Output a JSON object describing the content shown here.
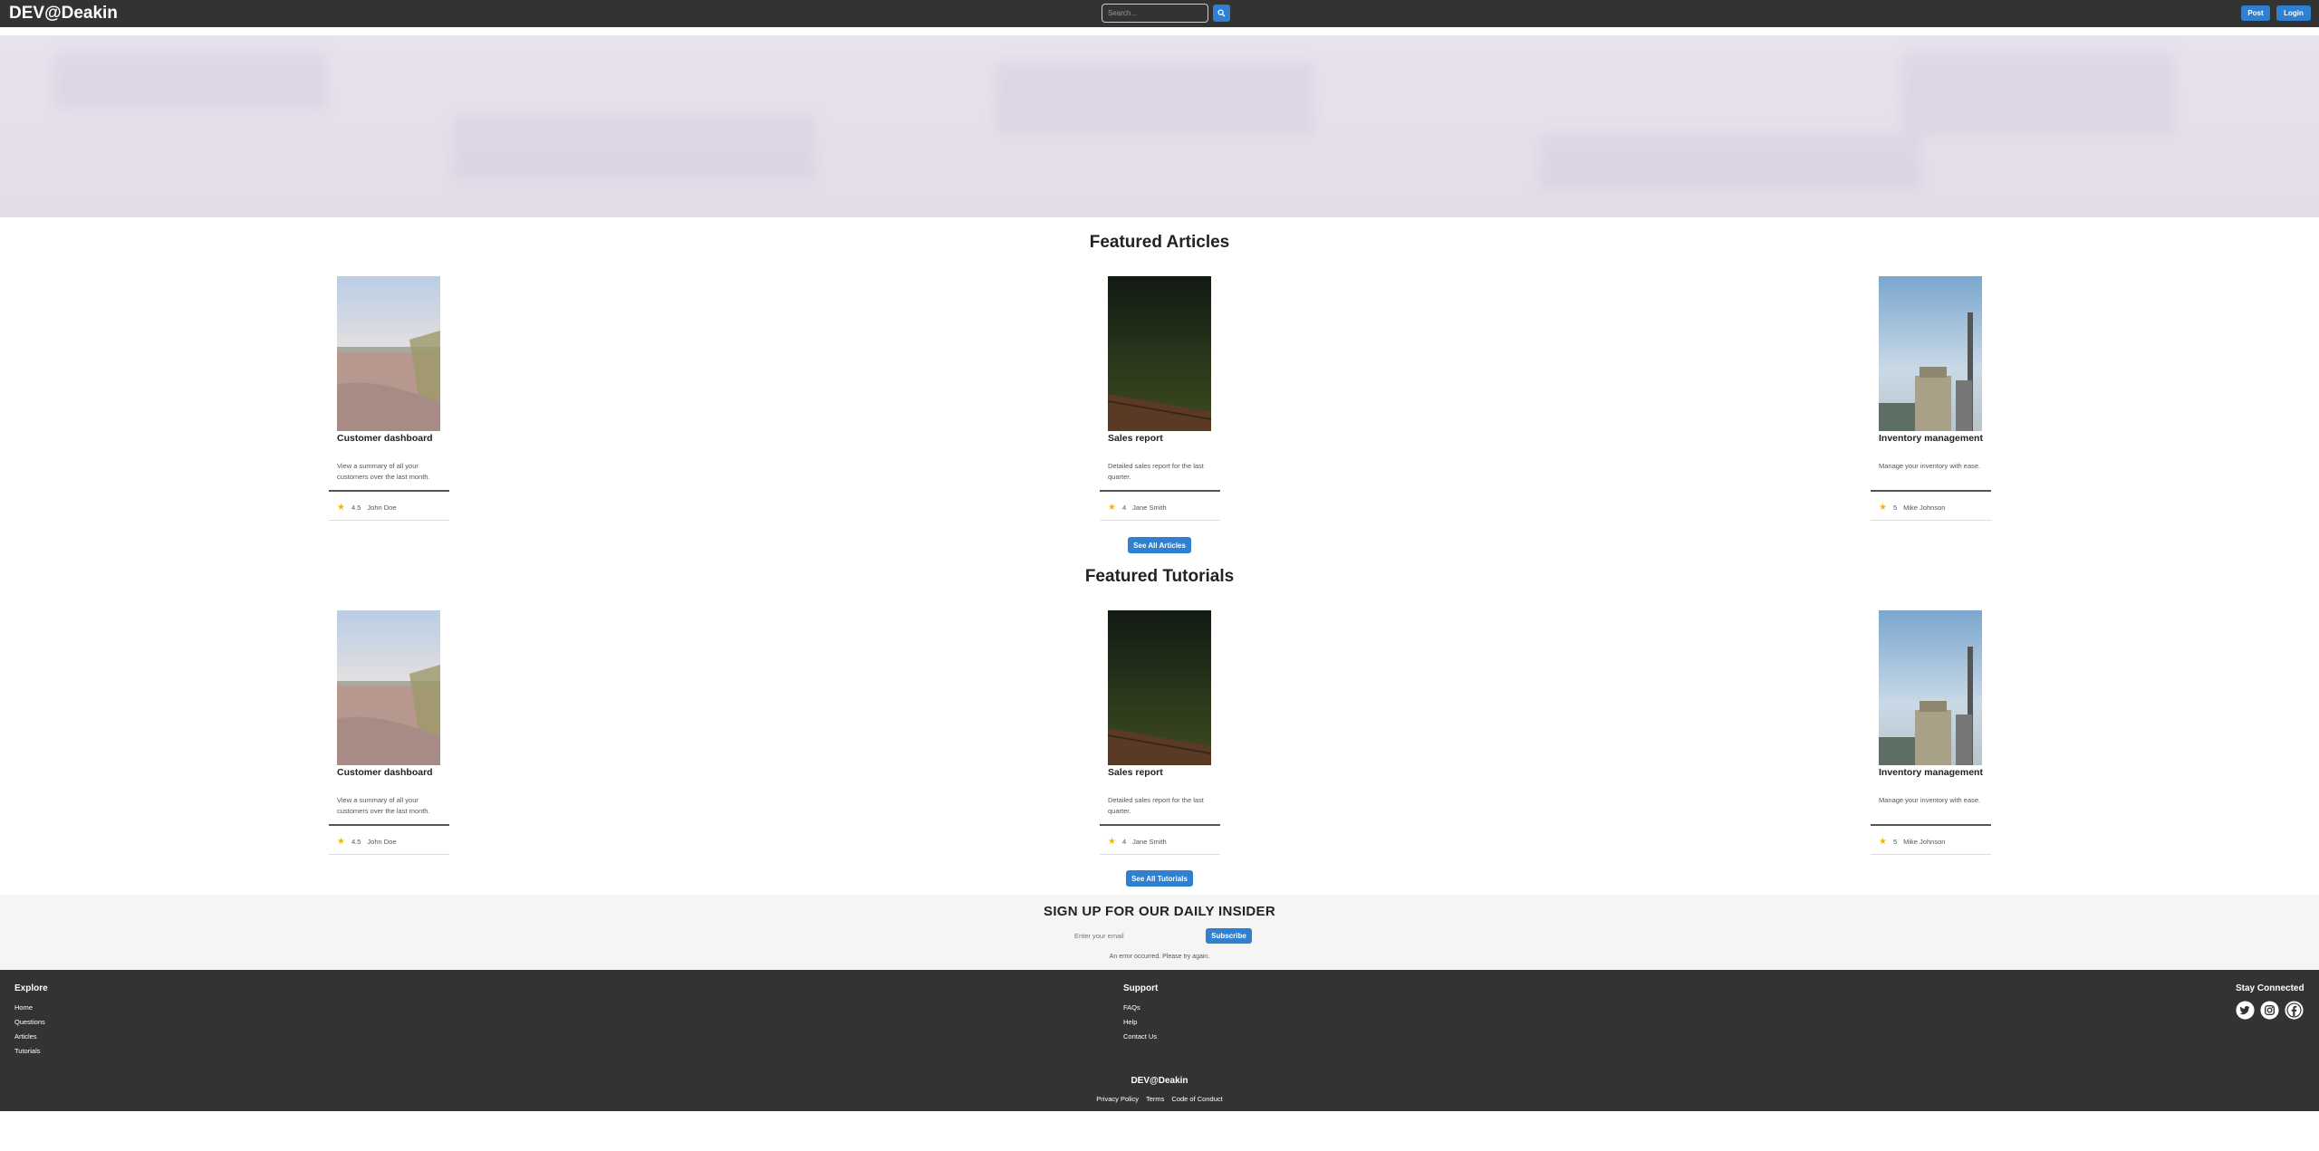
{
  "header": {
    "brand": "DEV@Deakin",
    "search_placeholder": "Search...",
    "post_label": "Post",
    "login_label": "Login"
  },
  "articles": {
    "title": "Featured Articles",
    "see_all_label": "See All Articles",
    "cards": [
      {
        "title": "Customer dashboard",
        "description": "View a summary of all your customers over the last month.",
        "rating": "4.5",
        "author": "John Doe",
        "image": "beach-photo"
      },
      {
        "title": "Sales report",
        "description": "Detailed sales report for the last quarter.",
        "rating": "4",
        "author": "Jane Smith",
        "image": "night-sky-photo"
      },
      {
        "title": "Inventory management",
        "description": "Manage your inventory with ease.",
        "rating": "5",
        "author": "Mike Johnson",
        "image": "industrial-tower-photo"
      }
    ]
  },
  "tutorials": {
    "title": "Featured Tutorials",
    "see_all_label": "See All Tutorials",
    "cards": [
      {
        "title": "Customer dashboard",
        "description": "View a summary of all your customers over the last month.",
        "rating": "4.5",
        "author": "John Doe",
        "image": "beach-photo"
      },
      {
        "title": "Sales report",
        "description": "Detailed sales report for the last quarter.",
        "rating": "4",
        "author": "Jane Smith",
        "image": "night-sky-photo"
      },
      {
        "title": "Inventory management",
        "description": "Manage your inventory with ease.",
        "rating": "5",
        "author": "Mike Johnson",
        "image": "industrial-tower-photo"
      }
    ]
  },
  "newsletter": {
    "title": "SIGN UP FOR OUR DAILY INSIDER",
    "email_placeholder": "Enter your email",
    "subscribe_label": "Subscribe",
    "error_text": "An error occurred. Please try again."
  },
  "footer": {
    "explore": {
      "title": "Explore",
      "links": [
        "Home",
        "Questions",
        "Articles",
        "Tutorials"
      ]
    },
    "support": {
      "title": "Support",
      "links": [
        "FAQs",
        "Help",
        "Contact Us"
      ]
    },
    "social": {
      "title": "Stay Connected",
      "icons": [
        "twitter-icon",
        "instagram-icon",
        "facebook-icon"
      ]
    },
    "brand": "DEV@Deakin",
    "legal": [
      "Privacy Policy",
      "Terms",
      "Code of Conduct"
    ]
  },
  "colors": {
    "header_bg": "#333333",
    "accent": "#2f80d0",
    "hero_bg": "#e5e0eb",
    "newsletter_bg": "#f5f5f5",
    "star": "#f2b705"
  }
}
